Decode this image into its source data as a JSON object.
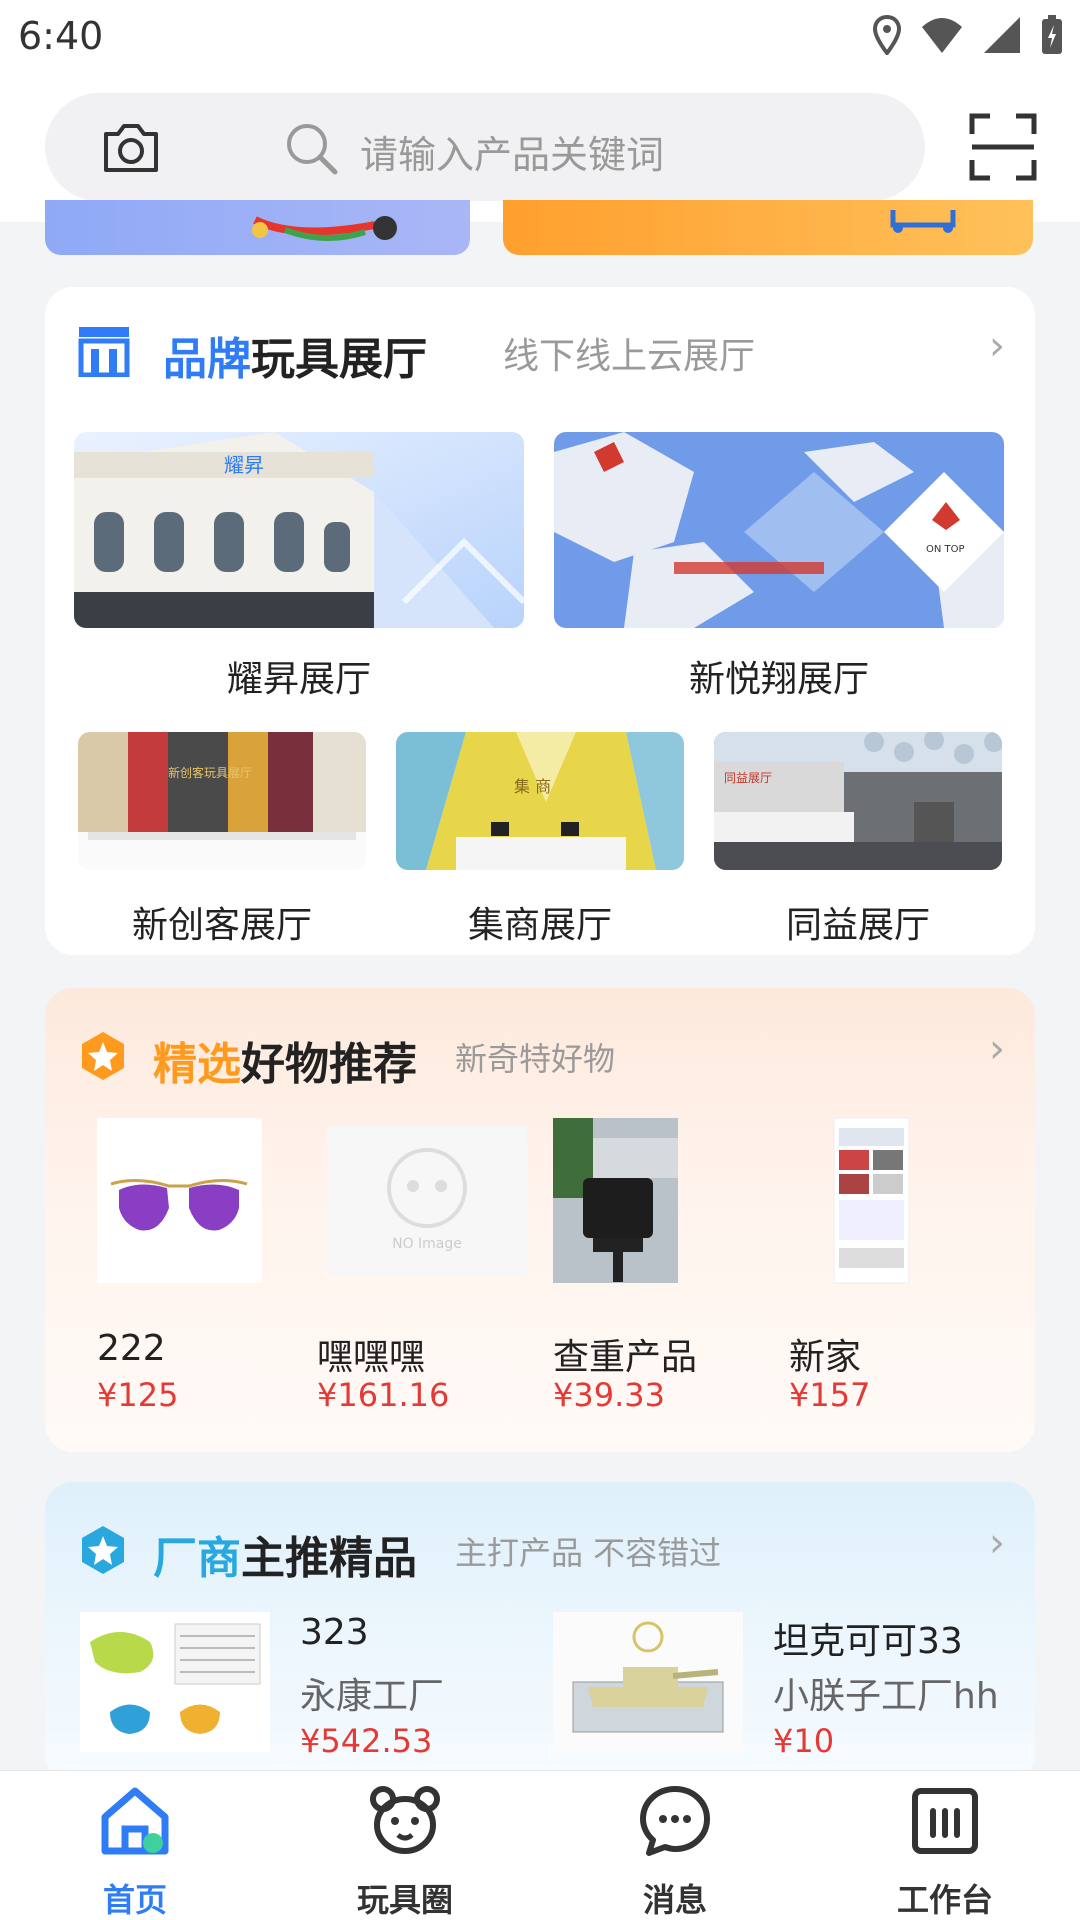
{
  "status_bar": {
    "time": "6:40"
  },
  "search": {
    "placeholder": "请输入产品关键词"
  },
  "showroom": {
    "title_accent": "品牌",
    "title_rest": "玩具展厅",
    "subtitle": "线下线上云展厅",
    "halls": [
      {
        "label": "耀昇展厅"
      },
      {
        "label": "新悦翔展厅"
      },
      {
        "label": "新创客展厅"
      },
      {
        "label": "集商展厅"
      },
      {
        "label": "同益展厅"
      }
    ],
    "image_text": {
      "hall1_sign": "耀昇",
      "hall2_sign": "ON TOP",
      "hall3_sign": "新创客玩具展厅",
      "hall4_sign": "集 商",
      "hall5_sign": "同益展厅"
    }
  },
  "picks": {
    "title_accent": "精选",
    "title_rest": "好物推荐",
    "subtitle": "新奇特好物",
    "no_image_text": "NO Image",
    "items": [
      {
        "name": "222",
        "price": "¥125"
      },
      {
        "name": "嘿嘿嘿",
        "price": "¥161.16"
      },
      {
        "name": "查重产品",
        "price": "¥39.33"
      },
      {
        "name": "新家",
        "price": "¥157"
      }
    ]
  },
  "manufacturer": {
    "title_accent": "厂商",
    "title_rest": "主推精品",
    "subtitle": "主打产品 不容错过",
    "items": [
      {
        "name": "323",
        "shop": "永康工厂",
        "price": "¥542.53"
      },
      {
        "name": "坦克可可33",
        "shop": "小朕子工厂hh",
        "price": "¥10"
      }
    ]
  },
  "bottom_nav": {
    "items": [
      {
        "label": "首页",
        "icon": "home-icon",
        "active": true
      },
      {
        "label": "玩具圈",
        "icon": "bear-icon",
        "active": false
      },
      {
        "label": "消息",
        "icon": "chat-icon",
        "active": false
      },
      {
        "label": "工作台",
        "icon": "dashboard-icon",
        "active": false
      }
    ]
  },
  "colors": {
    "accent": "#2f7cf6",
    "price": "#e53935",
    "picks_icon": "#ff9a1f",
    "mfr_icon": "#29a8e0"
  }
}
